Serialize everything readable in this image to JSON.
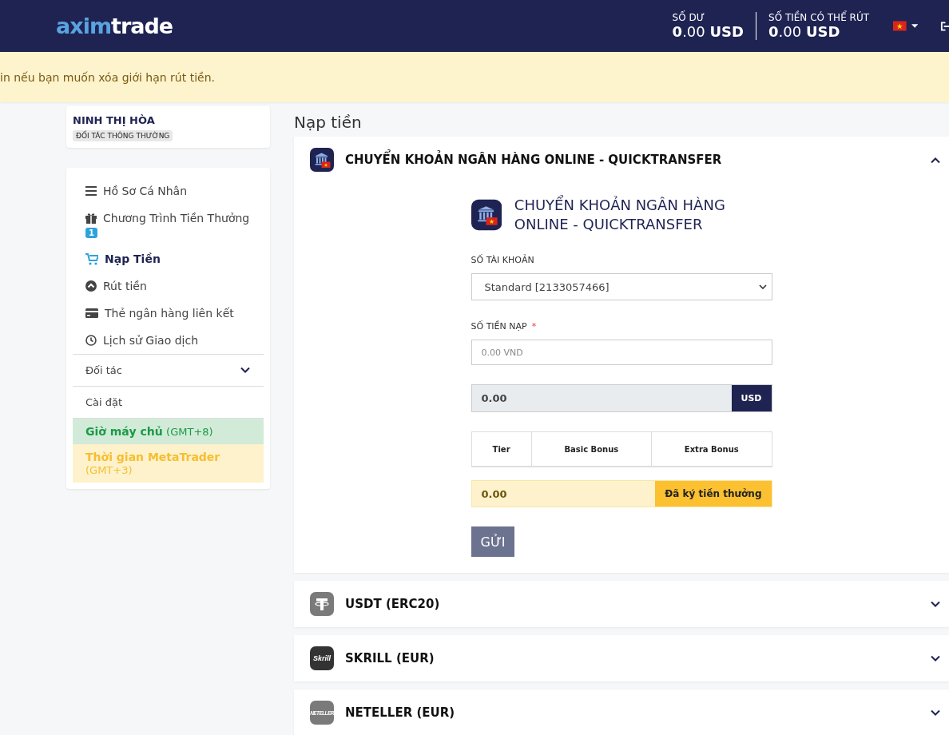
{
  "header": {
    "logo": [
      "axim",
      "trade"
    ],
    "balances": [
      {
        "label": "SỐ DƯ",
        "amount": "**0**.00 **USD**"
      },
      {
        "label": "SỐ TIỀN CÓ THỂ RÚT",
        "amount": "**0**.00 **USD**"
      }
    ]
  },
  "notice": "in nếu bạn muốn xóa giới hạn rút tiền.",
  "profile": {
    "name": "NINH THỊ HÒA",
    "badge": "ĐỐI TÁC THÔNG THƯỜNG"
  },
  "sidebar": {
    "items": [
      {
        "kind": "profile",
        "label": "Hồ Sơ Cá Nhân",
        "selected": false
      },
      {
        "kind": "bonus",
        "label": "Chương Trình Tiền Thưởng",
        "badge": "1",
        "selected": false
      },
      {
        "kind": "deposit",
        "label": "Nạp Tiền",
        "selected": true
      },
      {
        "kind": "withdraw",
        "label": "Rút tiền",
        "selected": false
      },
      {
        "kind": "card",
        "label": "Thẻ ngân hàng liên kết",
        "selected": false
      },
      {
        "kind": "history",
        "label": "Lịch sử Giao dịch",
        "selected": false
      }
    ],
    "sections": [
      {
        "label": "Đối tác",
        "expanded": false
      },
      {
        "label": "Cài đặt"
      }
    ],
    "clocks": [
      {
        "kind": "server",
        "label": "Giờ máy chủ",
        "zone": "(GMT+8)"
      },
      {
        "kind": "metatrader",
        "label": "Thời gian MetaTrader",
        "zone": "(GMT+3)"
      }
    ]
  },
  "main": {
    "title": "Nạp tiền",
    "methods": [
      {
        "kind": "bank",
        "title": "CHUYỂN KHOẢN NGÂN HÀNG ONLINE - QUICKTRANSFER",
        "expanded": true
      },
      {
        "kind": "tether",
        "title": "USDT (ERC20)",
        "expanded": false
      },
      {
        "kind": "skrill",
        "title": "SKRILL (EUR)",
        "logo_text": "Skrill",
        "expanded": false
      },
      {
        "kind": "neteller",
        "title": "NETELLER (EUR)",
        "logo_text": "NETELLER",
        "expanded": false
      }
    ],
    "form": {
      "heading": "CHUYỂN KHOẢN NGÂN HÀNG ONLINE - QUICKTRANSFER",
      "account_label": "SỐ TÀI KHOẢN",
      "account_value": "Standard [2133057466]",
      "amount_label": "SỐ TIỀN NẠP",
      "required_mark": "*",
      "amount_placeholder": "0.00 VND",
      "converted_value": "0.00",
      "converted_currency": "USD",
      "bonus_columns": [
        "Tier",
        "Basic Bonus",
        "Extra Bonus"
      ],
      "bonus_value": "0.00",
      "bonus_button": "Đã ký tiền thưởng",
      "submit": "GỬI"
    }
  }
}
